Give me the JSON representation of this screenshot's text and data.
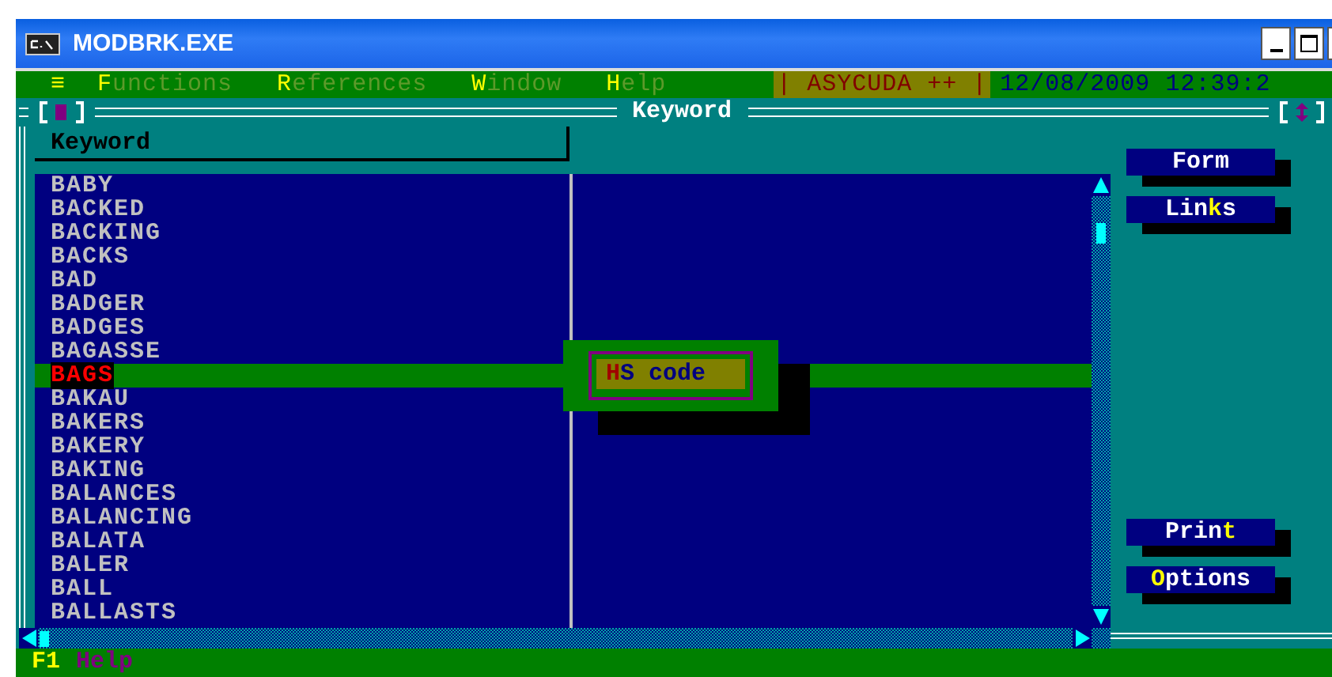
{
  "window": {
    "title": "MODBRK.EXE"
  },
  "menu_bar": {
    "system_menu": "≡",
    "items": [
      {
        "parts": [
          {
            "text": "F",
            "hotkey": true
          },
          {
            "text": "unctions",
            "hotkey": false
          }
        ]
      },
      {
        "parts": [
          {
            "text": "R",
            "hotkey": true
          },
          {
            "text": "eferences",
            "hotkey": false
          }
        ]
      },
      {
        "parts": [
          {
            "text": "W",
            "hotkey": true
          },
          {
            "text": "indow",
            "hotkey": false
          }
        ]
      },
      {
        "parts": [
          {
            "text": "H",
            "hotkey": true
          },
          {
            "text": "elp",
            "hotkey": false
          }
        ]
      }
    ],
    "product": "| ASYCUDA ++ |",
    "datetime": "12/08/2009 12:39:2"
  },
  "frame": {
    "title": "Keyword",
    "column_header": "Keyword"
  },
  "keywords": [
    {
      "text": "BABY",
      "selected": false
    },
    {
      "text": "BACKED",
      "selected": false
    },
    {
      "text": "BACKING",
      "selected": false
    },
    {
      "text": "BACKS",
      "selected": false
    },
    {
      "text": "BAD",
      "selected": false
    },
    {
      "text": "BADGER",
      "selected": false
    },
    {
      "text": "BADGES",
      "selected": false
    },
    {
      "text": "BAGASSE",
      "selected": false
    },
    {
      "text": "BAGS",
      "selected": true
    },
    {
      "text": "BAKAU",
      "selected": false
    },
    {
      "text": "BAKERS",
      "selected": false
    },
    {
      "text": "BAKERY",
      "selected": false
    },
    {
      "text": "BAKING",
      "selected": false
    },
    {
      "text": "BALANCES",
      "selected": false
    },
    {
      "text": "BALANCING",
      "selected": false
    },
    {
      "text": "BALATA",
      "selected": false
    },
    {
      "text": "BALER",
      "selected": false
    },
    {
      "text": "BALL",
      "selected": false
    },
    {
      "text": "BALLASTS",
      "selected": false
    }
  ],
  "popup": {
    "parts": [
      {
        "text": "H",
        "hotkey": true
      },
      {
        "text": "S code",
        "hotkey": false
      }
    ]
  },
  "side_buttons_top": [
    {
      "parts": [
        {
          "text": "Form",
          "hotkey": false
        }
      ]
    },
    {
      "parts": [
        {
          "text": "Lin",
          "hotkey": false
        },
        {
          "text": "k",
          "hotkey": true
        },
        {
          "text": "s",
          "hotkey": false
        }
      ]
    }
  ],
  "side_buttons_bottom": [
    {
      "parts": [
        {
          "text": "Prin",
          "hotkey": false
        },
        {
          "text": "t",
          "hotkey": true
        }
      ]
    },
    {
      "parts": [
        {
          "text": "O",
          "hotkey": true
        },
        {
          "text": "ptions",
          "hotkey": false
        }
      ]
    }
  ],
  "status_bar": {
    "key": "F1",
    "label": "Help"
  }
}
